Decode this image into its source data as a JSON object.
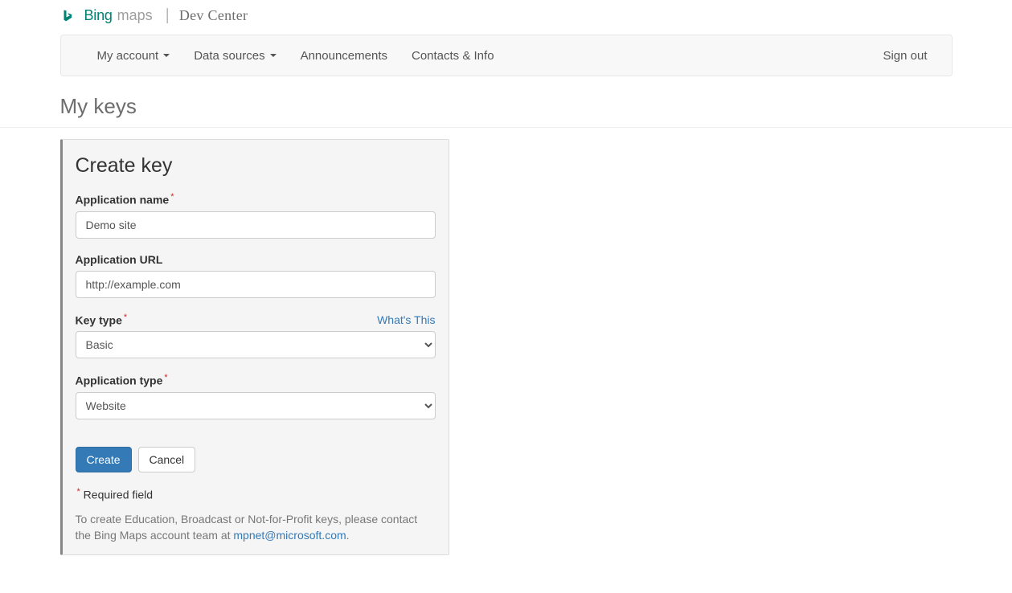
{
  "logo": {
    "brand_left": "Bing",
    "brand_right": "maps",
    "sep": "|",
    "portal": "Dev Center"
  },
  "nav": {
    "my_account": "My account",
    "data_sources": "Data sources",
    "announcements": "Announcements",
    "contacts_info": "Contacts & Info",
    "sign_out": "Sign out"
  },
  "page": {
    "title": "My keys"
  },
  "form": {
    "panel_title": "Create key",
    "app_name": {
      "label": "Application name",
      "value": "Demo site"
    },
    "app_url": {
      "label": "Application URL",
      "value": "http://example.com"
    },
    "key_type": {
      "label": "Key type",
      "help_link": "What's This",
      "selected": "Basic",
      "options": [
        "Basic"
      ]
    },
    "app_type": {
      "label": "Application type",
      "selected": "Website",
      "options": [
        "Website"
      ]
    },
    "buttons": {
      "create": "Create",
      "cancel": "Cancel"
    },
    "required_note": "Required field",
    "footer_note_prefix": "To create Education, Broadcast or Not-for-Profit keys, please contact the Bing Maps account team at ",
    "footer_note_link": "mpnet@microsoft.com",
    "footer_note_suffix": "."
  }
}
